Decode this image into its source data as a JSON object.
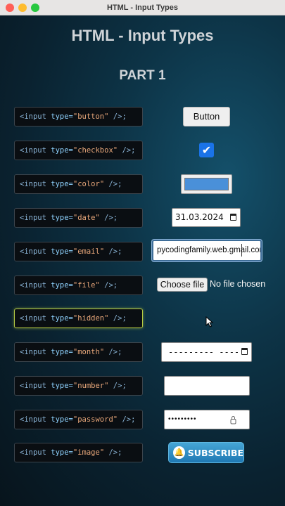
{
  "window": {
    "title": "HTML - Input Types"
  },
  "page": {
    "title": "HTML - Input Types",
    "part": "PART 1"
  },
  "rows": [
    {
      "type": "button"
    },
    {
      "type": "checkbox"
    },
    {
      "type": "color"
    },
    {
      "type": "date"
    },
    {
      "type": "email"
    },
    {
      "type": "file"
    },
    {
      "type": "hidden"
    },
    {
      "type": "month"
    },
    {
      "type": "number"
    },
    {
      "type": "password"
    },
    {
      "type": "image"
    }
  ],
  "code": {
    "open": "<input",
    "attr": "type=",
    "close": "/>;"
  },
  "demos": {
    "button_label": "Button",
    "checkbox_checked": true,
    "color_value": "#4a90d9",
    "date_value": "31.03.2024",
    "email_value": "pycodingfamily.web.gmail.com",
    "file_button": "Choose file",
    "file_status": "No file chosen",
    "month_value": "--------- ----",
    "number_value": "",
    "password_value": "•••••••••",
    "subscribe_label": "SUBSCRIBE"
  },
  "colors": {
    "accent": "#1a73e8",
    "focus_border": "#b3c844"
  }
}
